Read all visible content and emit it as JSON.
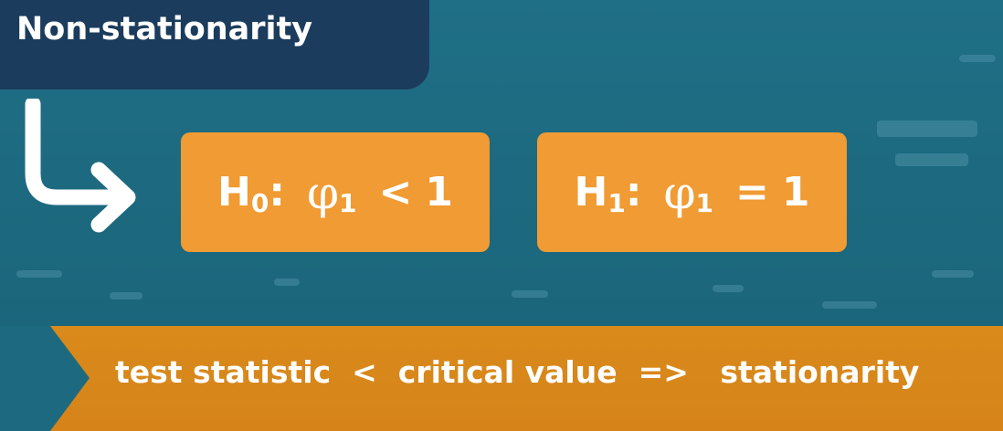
{
  "header": {
    "title": "Non-stationarity"
  },
  "hypotheses": {
    "h0": {
      "letter": "H",
      "subscript": "0",
      "colon": ":",
      "symbol": "φ",
      "symbol_sub": "1",
      "relation": "<",
      "value": "1"
    },
    "h1": {
      "letter": "H",
      "subscript": "1",
      "colon": ":",
      "symbol": "φ",
      "symbol_sub": "1",
      "relation": "=",
      "value": "1"
    }
  },
  "rule": {
    "left": "test statistic",
    "op": "<",
    "middle": "critical value",
    "implies": "=>",
    "right": "stationarity"
  },
  "colors": {
    "background": "#1e6d84",
    "title_tab": "#1b3c5c",
    "hypothesis_box": "#f09b33",
    "bottom_bar": "#d98a1a",
    "chevron": "#1d6a80",
    "text": "#ffffff"
  },
  "icons": {
    "arrow": "curved-down-right-arrow-icon",
    "chevron": "chevron-right-icon"
  }
}
